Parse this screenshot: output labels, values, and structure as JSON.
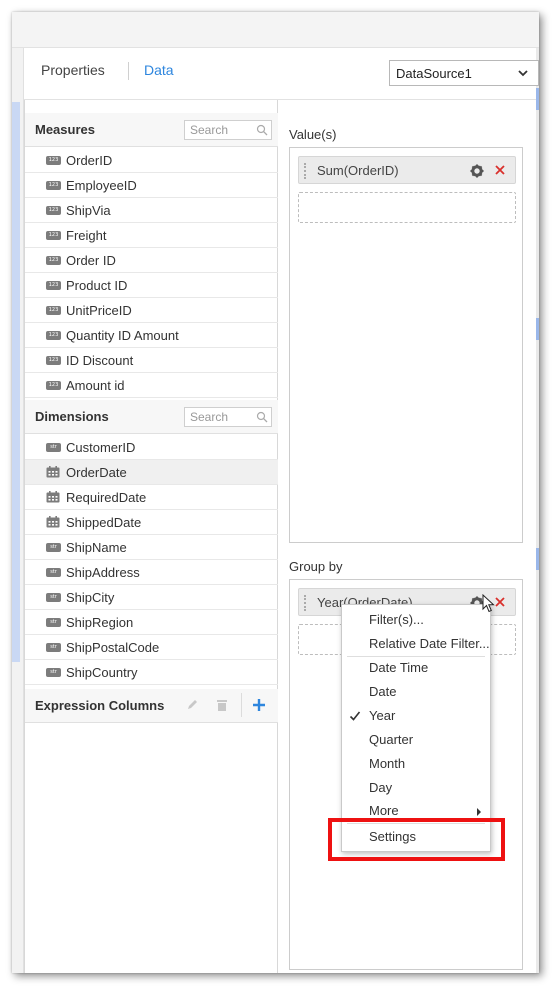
{
  "header": {
    "tabs": [
      {
        "label": "Properties",
        "active": false
      },
      {
        "label": "Data",
        "active": true
      }
    ],
    "datasource": {
      "selected": "DataSource1"
    }
  },
  "measures": {
    "title": "Measures",
    "search_placeholder": "Search",
    "type_badge": "123",
    "items": [
      "OrderID",
      "EmployeeID",
      "ShipVia",
      "Freight",
      "Order ID",
      "Product ID",
      "UnitPriceID",
      "Quantity ID Amount",
      "ID Discount",
      "Amount id"
    ]
  },
  "dimensions": {
    "title": "Dimensions",
    "search_placeholder": "Search",
    "type_badge": "str",
    "items": [
      {
        "label": "CustomerID",
        "type": "string"
      },
      {
        "label": "OrderDate",
        "type": "date",
        "selected": true
      },
      {
        "label": "RequiredDate",
        "type": "date"
      },
      {
        "label": "ShippedDate",
        "type": "date"
      },
      {
        "label": "ShipName",
        "type": "string"
      },
      {
        "label": "ShipAddress",
        "type": "string"
      },
      {
        "label": "ShipCity",
        "type": "string"
      },
      {
        "label": "ShipRegion",
        "type": "string"
      },
      {
        "label": "ShipPostalCode",
        "type": "string"
      },
      {
        "label": "ShipCountry",
        "type": "string"
      }
    ]
  },
  "expression_columns": {
    "title": "Expression Columns"
  },
  "values_section": {
    "label": "Value(s)",
    "item": "Sum(OrderID)"
  },
  "group_by_section": {
    "label": "Group by",
    "item": "Year(OrderDate)"
  },
  "context_menu": {
    "items": [
      "Filter(s)...",
      "Relative Date Filter...",
      "Date Time",
      "Date",
      "Year",
      "Quarter",
      "Month",
      "Day",
      "More",
      "Settings"
    ],
    "checked": "Year",
    "highlighted": "Settings"
  },
  "colors": {
    "accent": "#2e86de",
    "remove": "#d9302c",
    "highlight_border": "#ee1111"
  },
  "icons": [
    "chevron-down-icon",
    "search-icon",
    "calendar-icon",
    "edit-icon",
    "delete-icon",
    "plus-icon",
    "gear-icon",
    "close-icon",
    "checkmark-icon",
    "submenu-arrow-icon",
    "mouse-cursor-icon"
  ]
}
